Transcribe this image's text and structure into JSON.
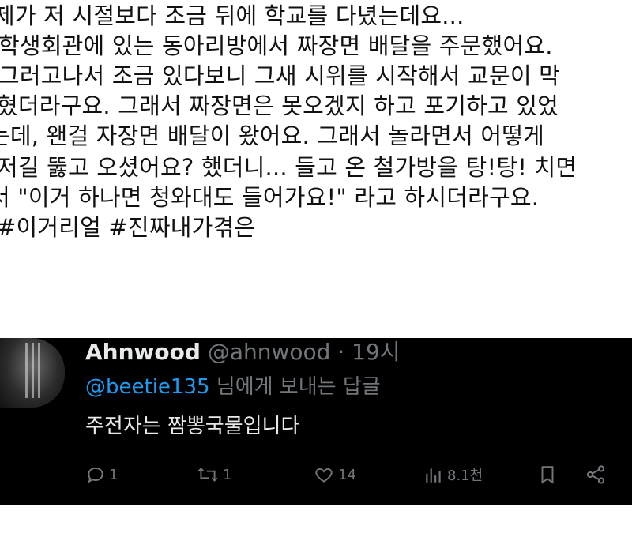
{
  "post": {
    "lines": [
      "제가 저 시절보다 조금 뒤에 학교를 다녔는데요...",
      "학생회관에 있는 동아리방에서 짜장면 배달을 주문했어요.",
      "그러고나서 조금 있다보니 그새 시위를 시작해서 교문이 막",
      "혔더라구요. 그래서 짜장면은 못오겠지 하고 포기하고 있었",
      "는데, 왠걸 자장면 배달이 왔어요. 그래서 놀라면서 어떻게",
      "저길 뚫고 오셨어요? 했더니... 들고 온 철가방을 탕!탕! 치면",
      "서 \"이거 하나면 청와대도 들어가요!\" 라고 하시더라구요.",
      "#이거리얼 #진짜내가겪은"
    ]
  },
  "reply": {
    "name": "Ahnwood",
    "handle": "@ahnwood",
    "time": "· 19시",
    "mention": "@beetie135",
    "replying_suffix": " 님에게 보내는 답글",
    "text": "주전자는 짬뽕국물입니다",
    "actions": {
      "reply_count": "1",
      "retweet_count": "1",
      "like_count": "14",
      "view_count": "8.1천"
    },
    "icons": [
      "reply-icon",
      "retweet-icon",
      "like-icon",
      "views-icon",
      "bookmark-icon",
      "share-icon"
    ]
  },
  "colors": {
    "mention": "#1d9bf0",
    "muted": "#71767b",
    "reply_bg": "#000000"
  }
}
